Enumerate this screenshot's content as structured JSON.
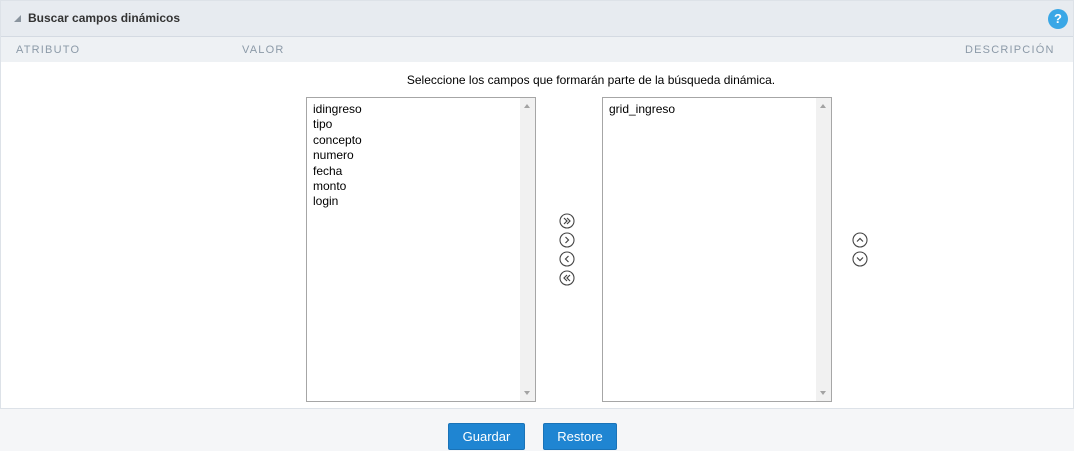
{
  "panel": {
    "title": "Buscar campos dinámicos",
    "help_icon": "?",
    "columns": {
      "attribute": "ATRIBUTO",
      "value": "VALOR",
      "description": "DESCRIPCIÓN"
    }
  },
  "instruction": "Seleccione los campos que formarán parte de la búsqueda dinámica.",
  "available_fields": [
    "idingreso",
    "tipo",
    "concepto",
    "numero",
    "fecha",
    "monto",
    "login"
  ],
  "selected_fields": [
    "grid_ingreso"
  ],
  "buttons": {
    "save": "Guardar",
    "restore": "Restore"
  },
  "icons": {
    "collapse": "triangle-collapse-icon",
    "move_all_right": "double-chevron-right-circle-icon",
    "move_right": "chevron-right-circle-icon",
    "move_left": "chevron-left-circle-icon",
    "move_all_left": "double-chevron-left-circle-icon",
    "move_up": "chevron-up-circle-icon",
    "move_down": "chevron-down-circle-icon"
  },
  "colors": {
    "accent": "#1f85d2",
    "help": "#3aa7e6",
    "header_bg": "#e7ebf0"
  }
}
